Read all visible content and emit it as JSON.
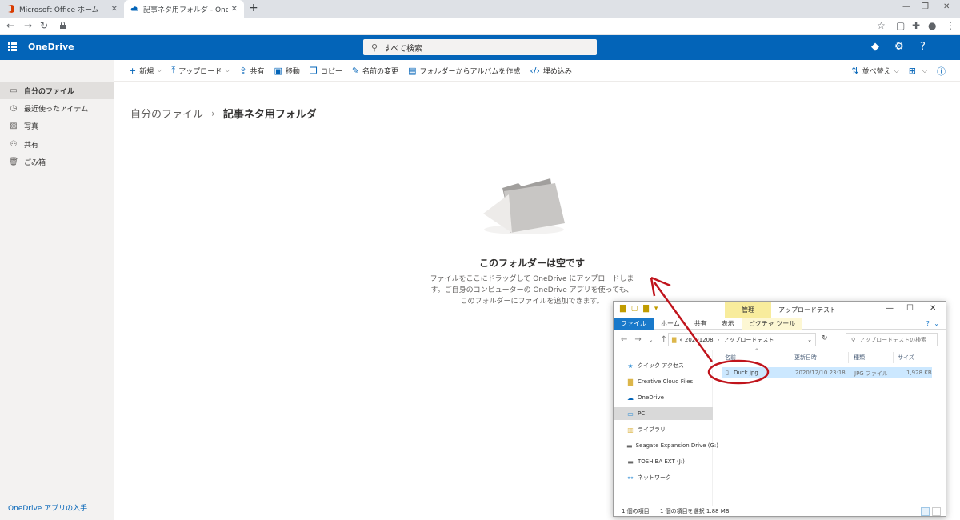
{
  "browser": {
    "tabs": [
      {
        "title": "Microsoft Office ホーム"
      },
      {
        "title": "記事ネタ用フォルダ - OneDrive"
      }
    ]
  },
  "suite": {
    "brand": "OneDrive",
    "search_placeholder": "すべて検索",
    "accent": "#0364b8"
  },
  "commands": {
    "new": "新規",
    "upload": "アップロード",
    "share": "共有",
    "move": "移動",
    "copy": "コピー",
    "rename": "名前の変更",
    "create_album": "フォルダーからアルバムを作成",
    "embed": "埋め込み",
    "sort": "並べ替え"
  },
  "nav": {
    "items": [
      {
        "label": "自分のファイル",
        "icon": "folder-icon"
      },
      {
        "label": "最近使ったアイテム",
        "icon": "clock-icon"
      },
      {
        "label": "写真",
        "icon": "image-icon"
      },
      {
        "label": "共有",
        "icon": "person-icon"
      },
      {
        "label": "ごみ箱",
        "icon": "trash-icon"
      }
    ],
    "get_app": "OneDrive アプリの入手"
  },
  "breadcrumb": {
    "root": "自分のファイル",
    "current": "記事ネタ用フォルダ"
  },
  "empty_state": {
    "title": "このフォルダーは空です",
    "line1": "ファイルをここにドラッグして OneDrive にアップロードしま",
    "line2": "す。ご自身のコンピューターの OneDrive アプリを使っても、",
    "line3": "このフォルダーにファイルを追加できます。"
  },
  "explorer": {
    "context_tab": "管理",
    "window_title": "アップロードテスト",
    "ribbon_tabs": [
      "ファイル",
      "ホーム",
      "共有",
      "表示",
      "ピクチャ ツール"
    ],
    "address_prefix": "«  20201208",
    "address_sep": "›",
    "address_current": "アップロードテスト",
    "search_placeholder": "アップロードテストの検索",
    "nav_items": [
      {
        "label": "クイック アクセス",
        "icon": "star-icon"
      },
      {
        "label": "Creative Cloud Files",
        "icon": "cloud-folder-icon"
      },
      {
        "label": "OneDrive",
        "icon": "cloud-icon"
      },
      {
        "label": "PC",
        "icon": "computer-icon"
      },
      {
        "label": "ライブラリ",
        "icon": "library-icon"
      },
      {
        "label": "Seagate Expansion Drive (G:)",
        "icon": "drive-icon"
      },
      {
        "label": "TOSHIBA EXT (J:)",
        "icon": "drive-icon"
      },
      {
        "label": "ネットワーク",
        "icon": "network-icon"
      }
    ],
    "columns": [
      "名前",
      "更新日時",
      "種類",
      "サイズ"
    ],
    "file": {
      "name": "Duck.jpg",
      "modified": "2020/12/10 23:18",
      "type": "JPG ファイル",
      "size": "1,928 KB"
    },
    "status_count": "1 個の項目",
    "status_selected": "1 個の項目を選択  1.88 MB"
  },
  "annotation": {
    "color": "#c0141c"
  }
}
